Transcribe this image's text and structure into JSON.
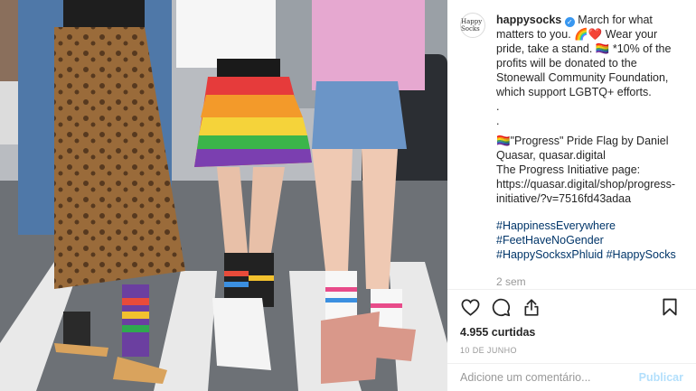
{
  "post": {
    "avatar_text": "Happy Socks",
    "username": "happysocks",
    "verified_mark": "✓",
    "caption_lines": [
      "March for what matters to you. 🌈❤️ Wear your pride, take a stand. 🏳️‍🌈 *10% of the profits will be donated to the Stonewall Community Foundation, which support LGBTQ+ efforts.",
      ".",
      ".",
      "🏳️‍🌈\"Progress\" Pride Flag by Daniel Quasar, quasar.digital",
      "The Progress Initiative page: https://quasar.digital/shop/progress-initiative/?v=7516fd43adaa"
    ],
    "hashtags": "#HappinessEverywhere #FeetHaveNoGender #HappySocksxPhluid #HappySocks",
    "time_ago": "2 sem",
    "likes": "4.955 curtidas",
    "date": "10 DE JUNHO"
  },
  "actions": {
    "like_icon": "heart-icon",
    "comment_icon": "comment-icon",
    "share_icon": "share-icon",
    "save_icon": "bookmark-icon"
  },
  "comment": {
    "placeholder": "Adicione um comentário...",
    "post_label": "Publicar"
  },
  "colors": {
    "link": "#003569",
    "verified": "#3897f0",
    "muted": "#999999",
    "post_button": "#b2dffc"
  }
}
